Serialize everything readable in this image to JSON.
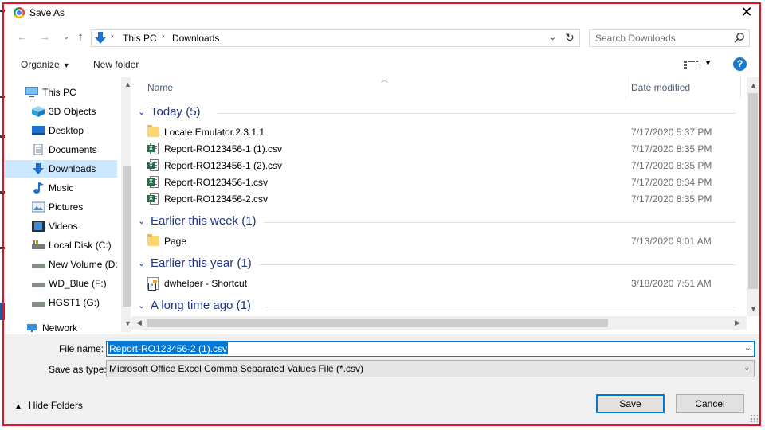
{
  "window": {
    "title": "Save As",
    "close_glyph": "✕"
  },
  "address_bar": {
    "location_icon": "downloads-arrow-icon",
    "breadcrumbs": [
      "This PC",
      "Downloads"
    ],
    "search_placeholder": "Search Downloads"
  },
  "command_bar": {
    "organize_label": "Organize",
    "new_folder_label": "New folder"
  },
  "nav_pane": {
    "items": [
      {
        "label": "This PC",
        "icon": "computer-icon",
        "selected": false
      },
      {
        "label": "3D Objects",
        "icon": "3d-objects-icon",
        "selected": false
      },
      {
        "label": "Desktop",
        "icon": "desktop-icon",
        "selected": false
      },
      {
        "label": "Documents",
        "icon": "documents-icon",
        "selected": false
      },
      {
        "label": "Downloads",
        "icon": "downloads-icon",
        "selected": true
      },
      {
        "label": "Music",
        "icon": "music-icon",
        "selected": false
      },
      {
        "label": "Pictures",
        "icon": "pictures-icon",
        "selected": false
      },
      {
        "label": "Videos",
        "icon": "videos-icon",
        "selected": false
      },
      {
        "label": "Local Disk (C:)",
        "icon": "local-disk-icon",
        "selected": false
      },
      {
        "label": "New Volume (D:",
        "icon": "drive-icon",
        "selected": false
      },
      {
        "label": "WD_Blue (F:)",
        "icon": "drive-icon",
        "selected": false
      },
      {
        "label": "HGST1 (G:)",
        "icon": "drive-icon",
        "selected": false
      },
      {
        "label": "Network",
        "icon": "network-icon",
        "selected": false
      }
    ]
  },
  "file_list": {
    "columns": {
      "name": "Name",
      "date_modified": "Date modified"
    },
    "groups": [
      {
        "title": "Today (5)",
        "files": [
          {
            "name": "Locale.Emulator.2.3.1.1",
            "date": "7/17/2020 5:37 PM",
            "icon": "folder-icon"
          },
          {
            "name": "Report-RO123456-1 (1).csv",
            "date": "7/17/2020 8:35 PM",
            "icon": "excel-csv-icon"
          },
          {
            "name": "Report-RO123456-1 (2).csv",
            "date": "7/17/2020 8:35 PM",
            "icon": "excel-csv-icon"
          },
          {
            "name": "Report-RO123456-1.csv",
            "date": "7/17/2020 8:34 PM",
            "icon": "excel-csv-icon"
          },
          {
            "name": "Report-RO123456-2.csv",
            "date": "7/17/2020 8:35 PM",
            "icon": "excel-csv-icon"
          }
        ]
      },
      {
        "title": "Earlier this week (1)",
        "files": [
          {
            "name": "Page",
            "date": "7/13/2020 9:01 AM",
            "icon": "folder-icon"
          }
        ]
      },
      {
        "title": "Earlier this year (1)",
        "files": [
          {
            "name": "dwhelper - Shortcut",
            "date": "3/18/2020 7:51 AM",
            "icon": "shortcut-icon"
          }
        ]
      },
      {
        "title": "A long time ago (1)",
        "files": []
      }
    ]
  },
  "form": {
    "file_name_label": "File name:",
    "file_name_value": "Report-RO123456-2 (1).csv",
    "save_type_label": "Save as type:",
    "save_type_value": "Microsoft Office Excel Comma Separated Values File (*.csv)",
    "hide_folders_label": "Hide Folders",
    "save_label": "Save",
    "cancel_label": "Cancel"
  },
  "colors": {
    "highlight_border": "#e81123",
    "accent": "#0078d7",
    "group_header": "#1e3287",
    "nav_selected": "#cce8ff"
  }
}
